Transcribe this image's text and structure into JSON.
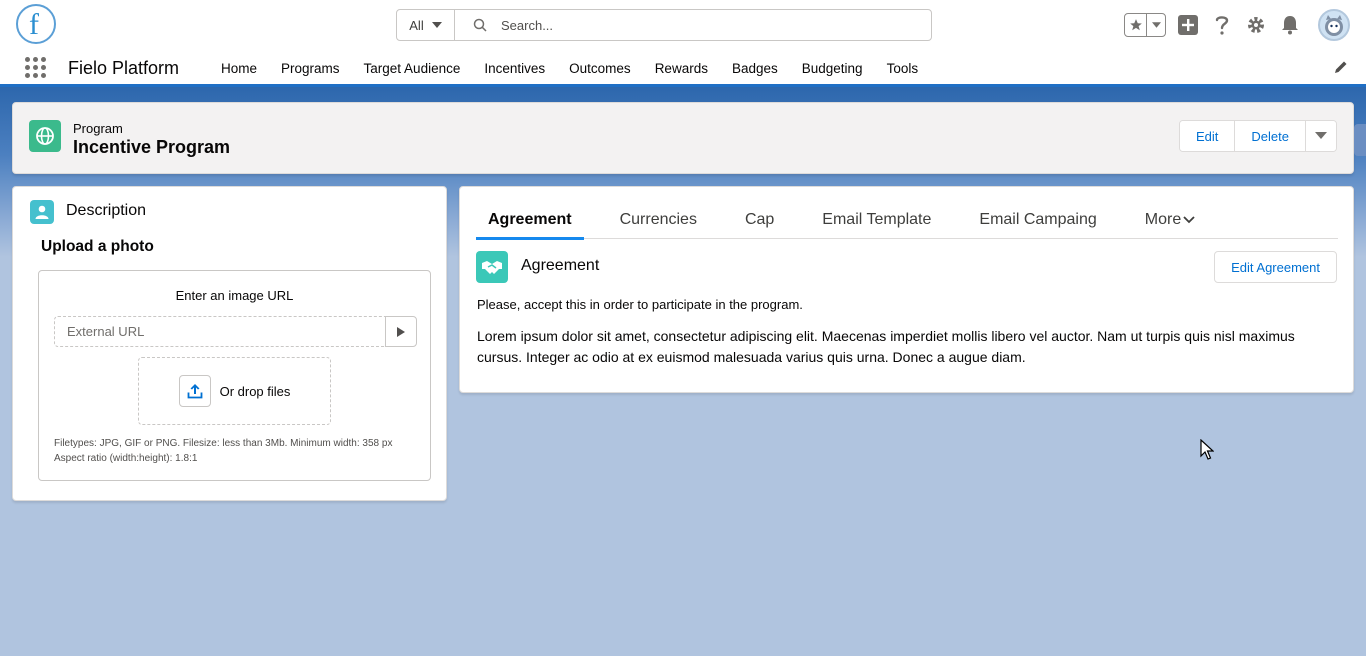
{
  "header": {
    "logo_letter": "f",
    "search_scope": "All",
    "search_placeholder": "Search...",
    "icons": [
      "favorites-star-icon",
      "chevron-down-icon",
      "add-icon",
      "help-icon",
      "setup-gear-icon",
      "notifications-bell-icon",
      "avatar"
    ]
  },
  "nav": {
    "app_name": "Fielo Platform",
    "items": [
      "Home",
      "Programs",
      "Target Audience",
      "Incentives",
      "Outcomes",
      "Rewards",
      "Badges",
      "Budgeting",
      "Tools"
    ]
  },
  "record": {
    "object_type": "Program",
    "name": "Incentive Program",
    "actions": {
      "edit": "Edit",
      "delete": "Delete"
    }
  },
  "description_card": {
    "title": "Description",
    "subtitle": "Upload a photo",
    "url_label": "Enter an image URL",
    "url_placeholder": "External URL",
    "drop_label": "Or drop files",
    "help_line1": "Filetypes: JPG, GIF or PNG. Filesize: less than 3Mb. Minimum width: 358 px",
    "help_line2": "Aspect ratio (width:height): 1.8:1"
  },
  "detail_card": {
    "tabs": [
      "Agreement",
      "Currencies",
      "Cap",
      "Email Template",
      "Email Campaing"
    ],
    "more_label": "More",
    "active_tab": "Agreement",
    "section_title": "Agreement",
    "edit_button": "Edit Agreement",
    "intro": "Please, accept this in order to participate in the program.",
    "body": "Lorem ipsum dolor sit amet, consectetur adipiscing elit. Maecenas imperdiet mollis libero vel auctor. Nam ut turpis quis nisl maximus cursus. Integer ac odio at ex euismod malesuada varius quis urna. Donec a augue diam."
  },
  "colors": {
    "brand_blue": "#1f6fc5",
    "program_icon": "#3bba8c",
    "description_icon": "#45c0ce",
    "agreement_icon": "#3bc8b8",
    "link": "#0070d2",
    "background": "#b0c4df"
  }
}
